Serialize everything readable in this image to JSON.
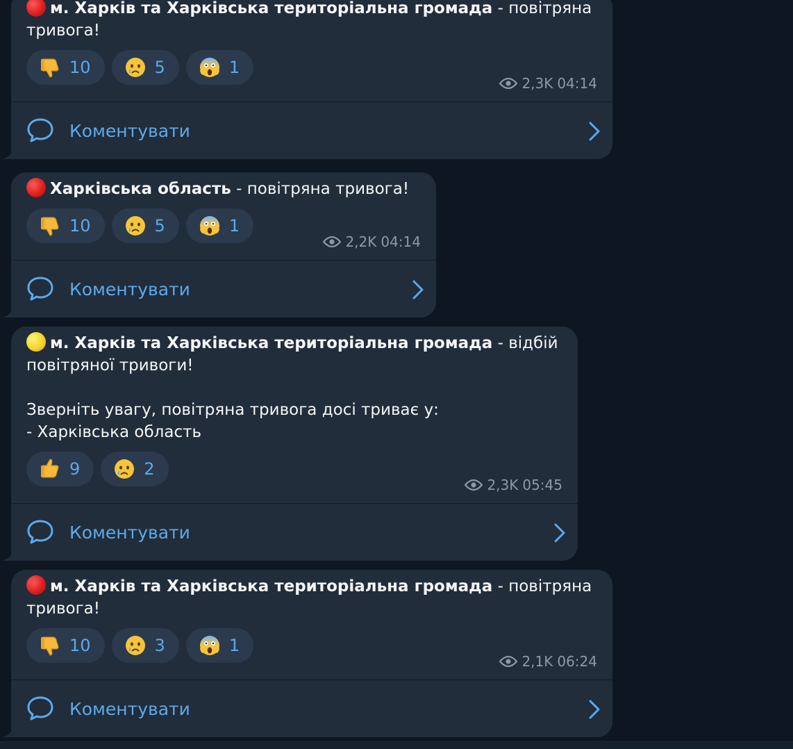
{
  "messages": [
    {
      "dot": "red",
      "bold": "м. Харків та Харківська територіальна громада",
      "rest": " - повітряна тривога!",
      "extra": "",
      "reactions": [
        {
          "icon": "thumbs-down-icon",
          "count": "10"
        },
        {
          "icon": "crying-face-icon",
          "count": "5"
        },
        {
          "icon": "screaming-face-icon",
          "count": "1"
        }
      ],
      "views": "2,3K",
      "time": "04:14",
      "comment_label": "Коментувати"
    },
    {
      "dot": "red",
      "bold": "Харківська область",
      "rest": " - повітряна тривога!",
      "extra": "",
      "reactions": [
        {
          "icon": "thumbs-down-icon",
          "count": "10"
        },
        {
          "icon": "crying-face-icon",
          "count": "5"
        },
        {
          "icon": "screaming-face-icon",
          "count": "1"
        }
      ],
      "views": "2,2K",
      "time": "04:14",
      "comment_label": "Коментувати"
    },
    {
      "dot": "yellow",
      "bold": "м. Харків та Харківська територіальна громада",
      "rest": " - відбій повітряної тривоги!",
      "extra": "Зверніть увагу, повітряна тривога досі триває у:\n- Харківська область",
      "reactions": [
        {
          "icon": "thumbs-up-icon",
          "count": "9"
        },
        {
          "icon": "crying-face-icon",
          "count": "2"
        }
      ],
      "views": "2,3K",
      "time": "05:45",
      "comment_label": "Коментувати"
    },
    {
      "dot": "red",
      "bold": "м. Харків та Харківська територіальна громада",
      "rest": " - повітряна тривога!",
      "extra": "",
      "reactions": [
        {
          "icon": "thumbs-down-icon",
          "count": "10"
        },
        {
          "icon": "crying-face-icon",
          "count": "3"
        },
        {
          "icon": "screaming-face-icon",
          "count": "1"
        }
      ],
      "views": "2,1K",
      "time": "06:24",
      "comment_label": "Коментувати"
    }
  ],
  "colors": {
    "background": "#0e1621",
    "bubble": "#212d3b",
    "accent": "#5ca9eb",
    "meta": "#8c99a7"
  }
}
